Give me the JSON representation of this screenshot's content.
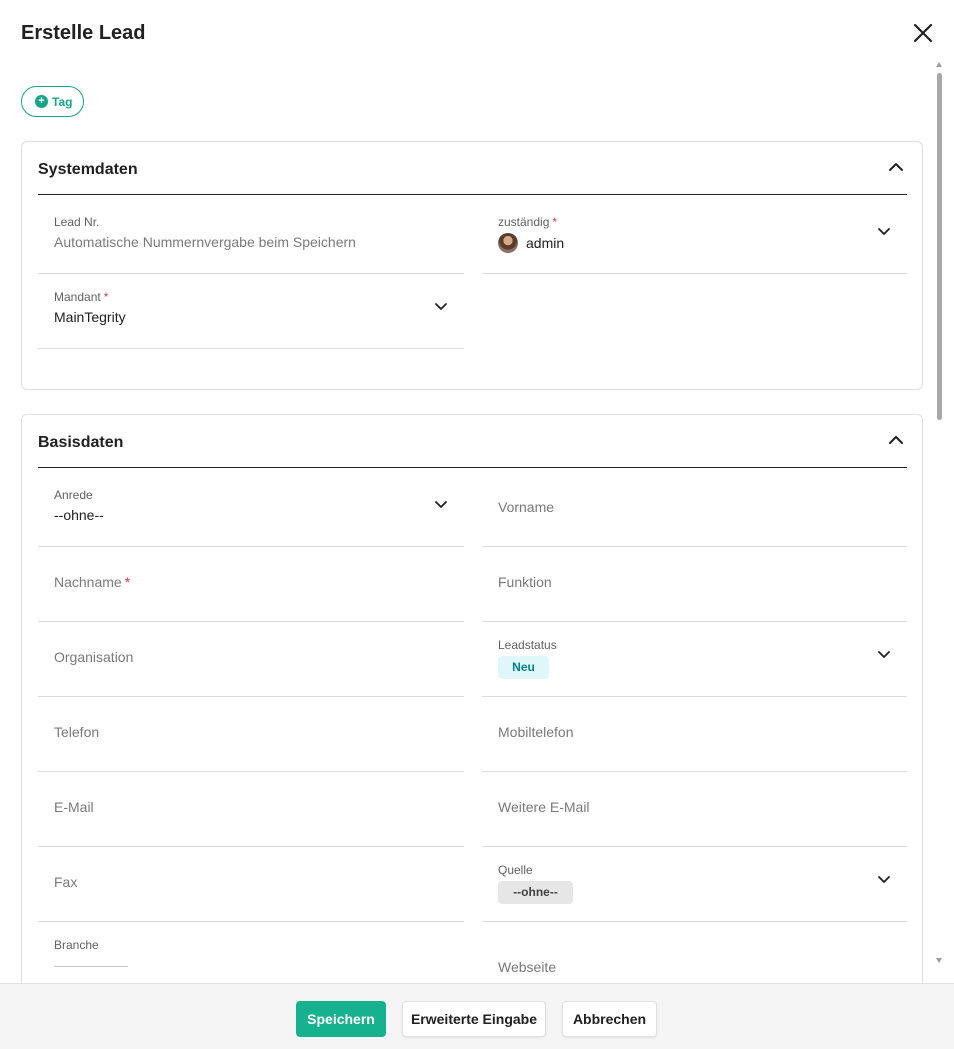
{
  "dialog": {
    "title": "Erstelle Lead"
  },
  "tag_button": {
    "label": "Tag"
  },
  "systemdaten": {
    "title": "Systemdaten",
    "lead_nr": {
      "label": "Lead Nr.",
      "value": "Automatische Nummernvergabe beim Speichern"
    },
    "zustaendig": {
      "label": "zuständig",
      "required": "*",
      "value": "admin"
    },
    "mandant": {
      "label": "Mandant",
      "required": "*",
      "value": "MainTegrity"
    }
  },
  "basisdaten": {
    "title": "Basisdaten",
    "anrede": {
      "label": "Anrede",
      "value": "--ohne--"
    },
    "vorname": {
      "placeholder": "Vorname"
    },
    "nachname": {
      "placeholder": "Nachname",
      "required": "*"
    },
    "funktion": {
      "placeholder": "Funktion"
    },
    "organisation": {
      "placeholder": "Organisation"
    },
    "leadstatus": {
      "label": "Leadstatus",
      "value": "Neu"
    },
    "telefon": {
      "placeholder": "Telefon"
    },
    "mobiltelefon": {
      "placeholder": "Mobiltelefon"
    },
    "email": {
      "placeholder": "E-Mail"
    },
    "weitere_email": {
      "placeholder": "Weitere E-Mail"
    },
    "fax": {
      "placeholder": "Fax"
    },
    "quelle": {
      "label": "Quelle",
      "value": "--ohne--"
    },
    "branche": {
      "label": "Branche"
    },
    "webseite": {
      "placeholder": "Webseite"
    }
  },
  "footer": {
    "save": "Speichern",
    "extended": "Erweiterte Eingabe",
    "cancel": "Abbrechen"
  },
  "colors": {
    "accent": "#16b28f",
    "required": "#e53935",
    "chip_neu_bg": "#e0f7fa",
    "chip_neu_text": "#00838f"
  }
}
